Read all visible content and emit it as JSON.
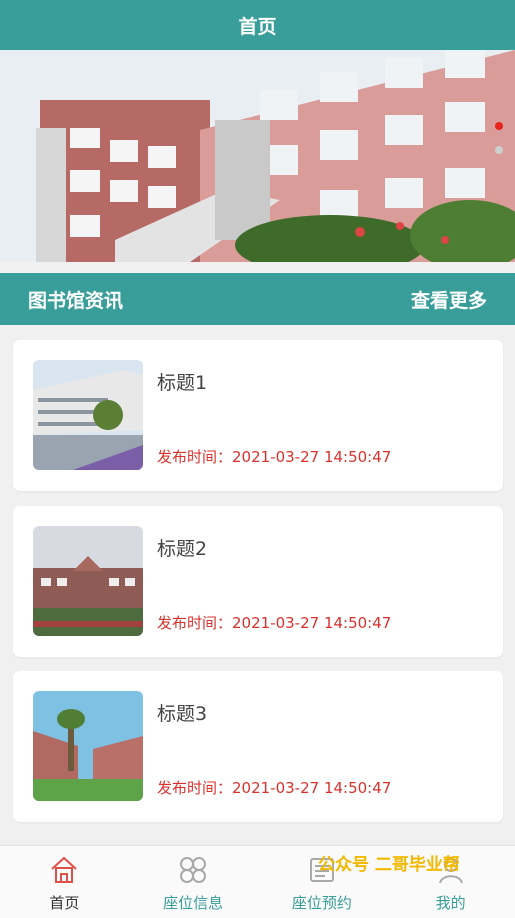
{
  "header": {
    "title": "首页"
  },
  "banner": {
    "slide_count": 2,
    "active_index": 0
  },
  "news": {
    "heading": "图书馆资讯",
    "more": "查看更多",
    "items": [
      {
        "title": "标题1",
        "time": "发布时间：2021-03-27 14:50:47"
      },
      {
        "title": "标题2",
        "time": "发布时间：2021-03-27 14:50:47"
      },
      {
        "title": "标题3",
        "time": "发布时间：2021-03-27 14:50:47"
      }
    ]
  },
  "tabbar": {
    "items": [
      {
        "label": "首页",
        "icon": "home-icon",
        "active": true
      },
      {
        "label": "座位信息",
        "icon": "grid-icon",
        "active": false
      },
      {
        "label": "座位预约",
        "icon": "calendar-icon",
        "active": false
      },
      {
        "label": "我的",
        "icon": "user-icon",
        "active": false
      }
    ]
  },
  "watermark": "公众号 二哥毕业帮",
  "colors": {
    "primary": "#399e9a",
    "accent_red": "#d9322d",
    "dot_active": "#e8231d"
  }
}
